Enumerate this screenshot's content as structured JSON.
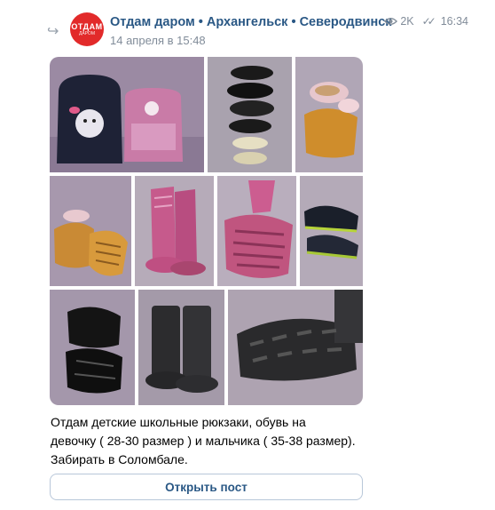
{
  "post": {
    "group_name": "Отдам даром • Архангельск • Северодвинск",
    "date": "14 апреля в 15:48",
    "views": "2K",
    "time": "16:34",
    "avatar_line1": "ОТДАМ",
    "avatar_line2": "ДАРОМ"
  },
  "photos": [
    {
      "name": "backpacks"
    },
    {
      "name": "black-shoes-stack"
    },
    {
      "name": "orange-clogs"
    },
    {
      "name": "orange-clogs-sole"
    },
    {
      "name": "pink-boots"
    },
    {
      "name": "pink-boots-sole"
    },
    {
      "name": "sneakers"
    },
    {
      "name": "black-sandals"
    },
    {
      "name": "black-rubber-boots"
    },
    {
      "name": "rubber-boots-sole"
    }
  ],
  "text": {
    "line1": "Отдам детские школьные рюкзаки, обувь на",
    "line2": "девочку ( 28-30 размер ) и мальчика ( 35-38 размер).",
    "line3": "Забирать в Соломбале."
  },
  "open_post_label": "Открыть пост",
  "colors": {
    "link": "#2a5885",
    "secondary": "#818c99",
    "avatar": "#e22a2a"
  }
}
